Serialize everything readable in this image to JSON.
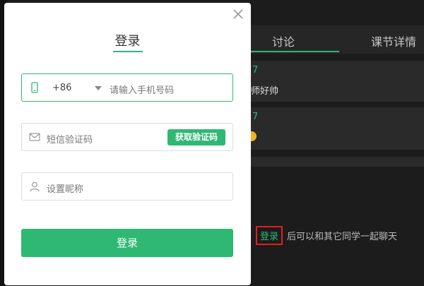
{
  "background": {
    "tabs": {
      "discuss": "讨论",
      "detail": "课节详情"
    },
    "messages": [
      {
        "num": "7",
        "text": "师好帅"
      },
      {
        "num": "7",
        "emoji": "smiley-emoji"
      }
    ],
    "login_prompt": {
      "link": "登录",
      "text": "后可以和其它同学一起聊天"
    }
  },
  "modal": {
    "title": "登录",
    "close_icon": "close-icon",
    "phone": {
      "country_code": "+86",
      "placeholder": "请输入手机号码",
      "icon": "phone-icon"
    },
    "sms": {
      "placeholder": "短信验证码",
      "button": "获取验证码",
      "icon": "mail-icon"
    },
    "nickname": {
      "placeholder": "设置昵称",
      "icon": "user-icon"
    },
    "submit": "登录"
  },
  "colors": {
    "accent": "#2fb874",
    "highlight": "#e0201d",
    "dark": "#1c1c1c"
  }
}
